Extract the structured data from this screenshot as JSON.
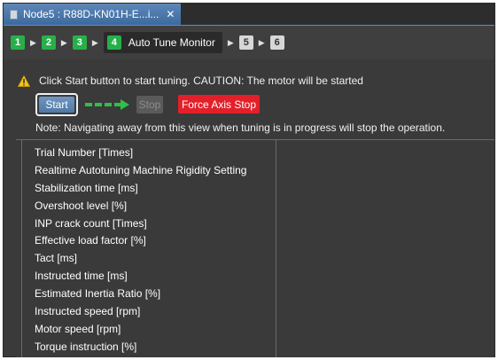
{
  "tab": {
    "title": "Node5 : R88D-KN01H-E...i...",
    "close_glyph": "✕"
  },
  "steps": [
    {
      "number": "1",
      "state": "done"
    },
    {
      "number": "2",
      "state": "done"
    },
    {
      "number": "3",
      "state": "done"
    },
    {
      "number": "4",
      "state": "current",
      "label": "Auto Tune Monitor"
    },
    {
      "number": "5",
      "state": "pending"
    },
    {
      "number": "6",
      "state": "pending"
    }
  ],
  "warning": {
    "text": "Click Start button to start tuning. CAUTION: The motor will be started"
  },
  "controls": {
    "start_label": "Start",
    "stop_label": "Stop",
    "force_stop_label": "Force Axis Stop"
  },
  "note": "Note: Navigating away from this view when tuning is in progress will stop the operation.",
  "parameters": [
    "Trial Number [Times]",
    "Realtime Autotuning Machine Rigidity Setting",
    "Stabilization time [ms]",
    "Overshoot level [%]",
    "INP crack count [Times]",
    "Effective load factor [%]",
    "Tact [ms]",
    "Instructed time [ms]",
    "Estimated Inertia Ratio [%]",
    "Instructed speed [rpm]",
    "Motor speed [rpm]",
    "Torque instruction [%]"
  ],
  "colors": {
    "step_done": "#27b04a",
    "force_stop": "#e3202a",
    "tab_active": "#4f7bae",
    "arrow_green": "#2fbf4a"
  }
}
